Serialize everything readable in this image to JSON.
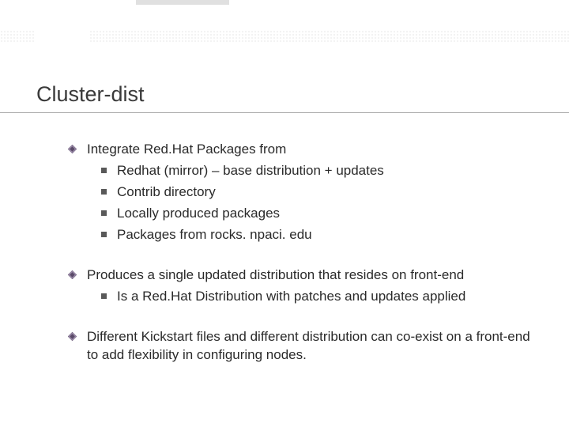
{
  "title": "Cluster-dist",
  "items": [
    {
      "text": "Integrate Red.Hat Packages from",
      "sub": [
        "Redhat (mirror) – base distribution + updates",
        "Contrib directory",
        "Locally produced packages",
        "Packages from rocks. npaci. edu"
      ]
    },
    {
      "text": "Produces a single updated distribution that resides on front-end",
      "sub": [
        " Is a Red.Hat Distribution with patches and updates applied"
      ]
    },
    {
      "text": "Different Kickstart files and different distribution can co-exist on a front-end to add flexibility in configuring nodes.",
      "sub": []
    }
  ]
}
